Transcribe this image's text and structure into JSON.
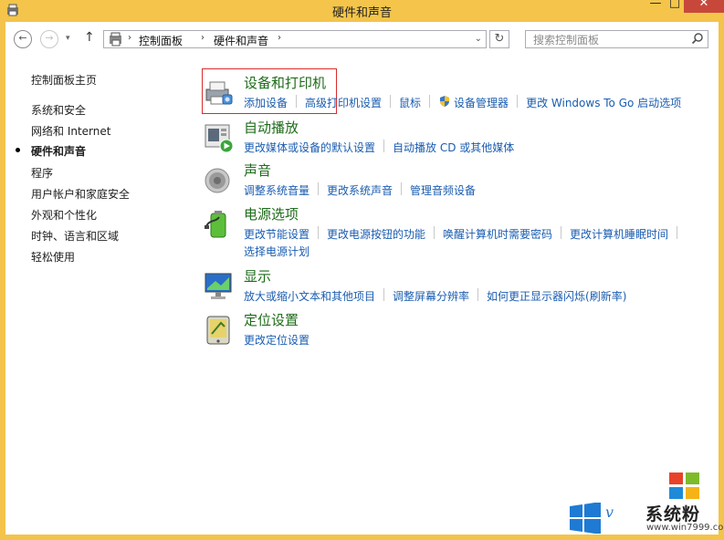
{
  "window": {
    "title": "硬件和声音",
    "buttons": {
      "minimize": "—",
      "maximize": "□",
      "close": "✕"
    }
  },
  "nav": {
    "back_icon": "←",
    "forward_icon": "→",
    "recent_icon": "▾",
    "up_icon": "↑",
    "breadcrumb": [
      "控制面板",
      "硬件和声音"
    ],
    "crumb_sep": "›",
    "dropdown_icon": "⌄",
    "refresh_icon": "↻",
    "search_placeholder": "搜索控制面板"
  },
  "sidebar": {
    "items": [
      {
        "label": "控制面板主页",
        "active": false
      },
      {
        "label": "系统和安全",
        "active": false
      },
      {
        "label": "网络和 Internet",
        "active": false
      },
      {
        "label": "硬件和声音",
        "active": true
      },
      {
        "label": "程序",
        "active": false
      },
      {
        "label": "用户帐户和家庭安全",
        "active": false
      },
      {
        "label": "外观和个性化",
        "active": false
      },
      {
        "label": "时钟、语言和区域",
        "active": false
      },
      {
        "label": "轻松使用",
        "active": false
      }
    ]
  },
  "categories": [
    {
      "title": "设备和打印机",
      "icon": "printer-icon",
      "links": [
        "添加设备",
        "高级打印机设置",
        "鼠标",
        "设备管理器",
        "更改 Windows To Go 启动选项"
      ]
    },
    {
      "title": "自动播放",
      "icon": "autoplay-icon",
      "links": [
        "更改媒体或设备的默认设置",
        "自动播放 CD 或其他媒体"
      ]
    },
    {
      "title": "声音",
      "icon": "speaker-icon",
      "links": [
        "调整系统音量",
        "更改系统声音",
        "管理音频设备"
      ]
    },
    {
      "title": "电源选项",
      "icon": "battery-icon",
      "links": [
        "更改节能设置",
        "更改电源按钮的功能",
        "唤醒计算机时需要密码",
        "更改计算机睡眠时间"
      ],
      "links2": [
        "选择电源计划"
      ]
    },
    {
      "title": "显示",
      "icon": "monitor-icon",
      "links": [
        "放大或缩小文本和其他项目",
        "调整屏幕分辨率",
        "如何更正显示器闪烁(刷新率)"
      ]
    },
    {
      "title": "定位设置",
      "icon": "location-icon",
      "links": [
        "更改定位设置"
      ]
    }
  ],
  "watermark": {
    "v_letter": "v",
    "brand": "系统粉",
    "url": "www.win7999.com"
  },
  "colors": {
    "titlebar": "#f4c54a",
    "link": "#1a5cb0",
    "category_title": "#1e6b1a",
    "highlight": "#d92a2a"
  }
}
